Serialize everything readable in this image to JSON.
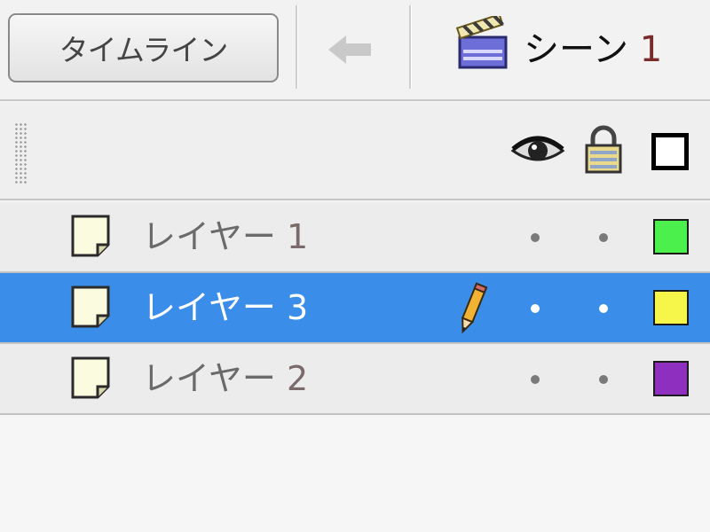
{
  "toolbar": {
    "timeline_label": "タイムライン",
    "scene_label": "シーン",
    "scene_number": "1"
  },
  "header": {
    "eye_icon": "eye-icon",
    "lock_icon": "lock-icon",
    "outline_icon": "outline-square-icon"
  },
  "layers": [
    {
      "label": "レイヤー",
      "number": "1",
      "color": "#4cf04c",
      "selected": false,
      "editing": false
    },
    {
      "label": "レイヤー",
      "number": "3",
      "color": "#f6f64a",
      "selected": true,
      "editing": true
    },
    {
      "label": "レイヤー",
      "number": "2",
      "color": "#8e2fc0",
      "selected": false,
      "editing": false
    }
  ],
  "colors": {
    "selection": "#3a8eea",
    "panel_bg": "#f3f3f3"
  }
}
